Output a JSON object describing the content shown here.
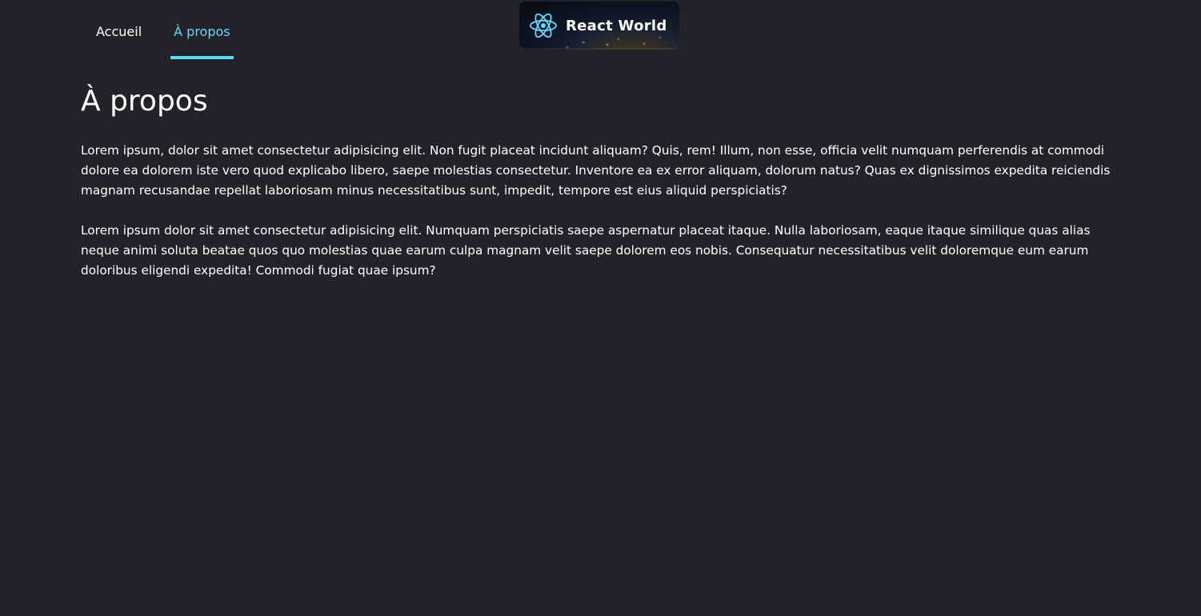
{
  "nav": {
    "items": [
      {
        "label": "Accueil",
        "active": false
      },
      {
        "label": "À propos",
        "active": true
      }
    ],
    "active_color": "#61dafb"
  },
  "logo": {
    "brand": "React World",
    "icon": "react-atom-icon"
  },
  "main": {
    "title": "À propos",
    "paragraphs": [
      "Lorem ipsum, dolor sit amet consectetur adipisicing elit. Non fugit placeat incidunt aliquam? Quis, rem! Illum, non esse, officia velit numquam perferendis at commodi dolore ea dolorem iste vero quod explicabo libero, saepe molestias consectetur. Inventore ea ex error aliquam, dolorum natus? Quas ex dignissimos expedita reiciendis magnam recusandae repellat laboriosam minus necessitatibus sunt, impedit, tempore est eius aliquid perspiciatis?",
      "Lorem ipsum dolor sit amet consectetur adipisicing elit. Numquam perspiciatis saepe aspernatur placeat itaque. Nulla laboriosam, eaque itaque similique quas alias neque animi soluta beatae quos quo molestias quae earum culpa magnam velit saepe dolorem eos nobis. Consequatur necessitatibus velit doloremque eum earum doloribus eligendi expedita! Commodi fugiat quae ipsum?"
    ]
  },
  "colors": {
    "background": "#21222a",
    "text": "#ffffff",
    "accent": "#61dafb"
  }
}
